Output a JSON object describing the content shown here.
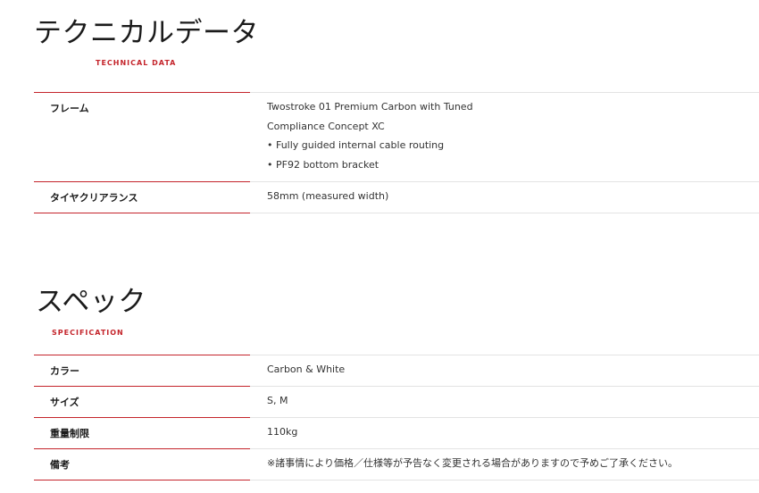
{
  "technical": {
    "title": "テクニカルデータ",
    "subtitle": "TECHNICAL DATA",
    "rows": [
      {
        "label": "フレーム",
        "value_lines": [
          "Twostroke 01 Premium Carbon with Tuned",
          "Compliance Concept XC",
          "• Fully guided internal cable routing",
          "• PF92 bottom bracket"
        ]
      },
      {
        "label": "タイヤクリアランス",
        "value_lines": [
          "58mm (measured width)"
        ]
      }
    ]
  },
  "spec": {
    "title": "スペック",
    "subtitle": "SPECIFICATION",
    "rows": [
      {
        "label": "カラー",
        "value": "Carbon & White"
      },
      {
        "label": "サイズ",
        "value": "S, M"
      },
      {
        "label": "重量制限",
        "value": "110kg"
      },
      {
        "label": "備考",
        "value": "※諸事情により価格／仕様等が予告なく変更される場合がありますので予めご了承ください。"
      }
    ]
  },
  "colors": {
    "accent": "#c4242b",
    "divider": "#e3e3e3",
    "text": "#222222"
  }
}
